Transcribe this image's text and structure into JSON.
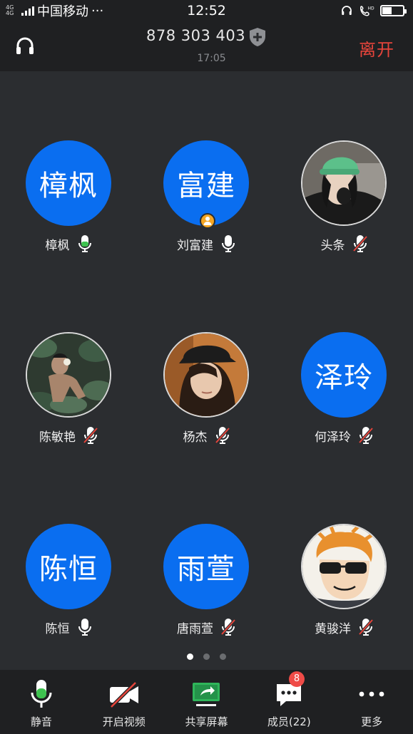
{
  "status_bar": {
    "network_tag": "4G 4G",
    "carrier": "中国移动",
    "more": "···",
    "time": "12:52",
    "battery_level": 0.45
  },
  "header": {
    "meeting_id": "878 303 403",
    "duration": "17:05",
    "leave_label": "离开"
  },
  "members": [
    {
      "avatar_text": "樟枫",
      "name": "樟枫",
      "mic": "active",
      "avatar_type": "text"
    },
    {
      "avatar_text": "富建",
      "name": "刘富建",
      "mic": "on",
      "avatar_type": "text",
      "host": true
    },
    {
      "avatar_text": "",
      "name": "头条",
      "mic": "muted",
      "avatar_type": "photo",
      "photo": "girl-green-hat"
    },
    {
      "avatar_text": "",
      "name": "陈敏艳",
      "mic": "muted",
      "avatar_type": "photo",
      "photo": "boy-with-leaves"
    },
    {
      "avatar_text": "",
      "name": "杨杰",
      "mic": "muted",
      "avatar_type": "photo",
      "photo": "girl-black-cap"
    },
    {
      "avatar_text": "泽玲",
      "name": "何泽玲",
      "mic": "muted",
      "avatar_type": "text"
    },
    {
      "avatar_text": "陈恒",
      "name": "陈恒",
      "mic": "on",
      "avatar_type": "text"
    },
    {
      "avatar_text": "雨萱",
      "name": "唐雨萱",
      "mic": "muted",
      "avatar_type": "text"
    },
    {
      "avatar_text": "",
      "name": "黄骏洋",
      "mic": "muted",
      "avatar_type": "photo",
      "photo": "cartoon-sunglasses"
    }
  ],
  "pager": {
    "pages": 3,
    "current": 1
  },
  "toolbar": {
    "items": [
      {
        "label": "静音",
        "icon": "mic-icon"
      },
      {
        "label": "开启视频",
        "icon": "video-off-icon"
      },
      {
        "label": "共享屏幕",
        "icon": "share-screen-icon"
      },
      {
        "label": "成员(22)",
        "icon": "members-chat-icon"
      },
      {
        "label": "更多",
        "icon": "more-icon"
      }
    ],
    "members_badge": "8"
  },
  "colors": {
    "accent_blue": "#0a6ef0",
    "leave_red": "#e5443b",
    "mic_green": "#3ec24f",
    "muted_red": "#e5443b",
    "host_orange": "#f5a623",
    "share_green": "#2fb55a"
  }
}
